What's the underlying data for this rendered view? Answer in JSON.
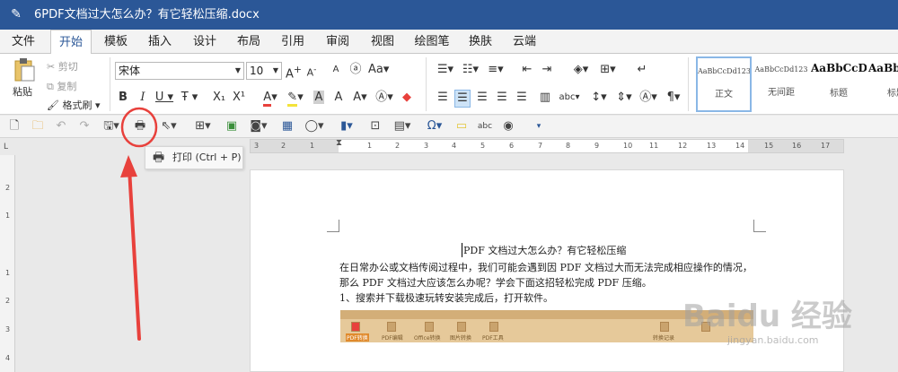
{
  "window": {
    "title": "6PDF文档过大怎么办？有它轻松压缩.docx"
  },
  "menu": {
    "tabs": [
      "文件",
      "开始",
      "模板",
      "插入",
      "设计",
      "布局",
      "引用",
      "审阅",
      "视图",
      "绘图笔",
      "换肤",
      "云端"
    ],
    "active": "开始"
  },
  "ribbon": {
    "clipboard": {
      "paste": "粘贴",
      "cut": "剪切",
      "copy": "复制",
      "format_painter": "格式刷"
    },
    "font": {
      "name": "宋体",
      "size": "10"
    },
    "styles": [
      {
        "sample": "AaBbCcDd123",
        "name": "正文"
      },
      {
        "sample": "AaBbCcDd123",
        "name": "无间距"
      },
      {
        "sample": "AaBbCcD",
        "name": "标题"
      },
      {
        "sample": "AaBbCcD",
        "name": "标题"
      }
    ]
  },
  "tooltip": {
    "text": "打印 (Ctrl + P)"
  },
  "ruler": {
    "h_ticks": [
      "3",
      "2",
      "1",
      "1",
      "2",
      "3",
      "4",
      "5",
      "6",
      "7",
      "8",
      "9",
      "10",
      "11",
      "12",
      "13",
      "14",
      "15",
      "16",
      "17"
    ],
    "v_ticks": [
      "2",
      "1",
      "1",
      "2",
      "3",
      "4"
    ]
  },
  "document": {
    "title": "PDF 文档过大怎么办？有它轻松压缩",
    "p1": "在日常办公或文档传阅过程中，我们可能会遇到因 PDF 文档过大而无法完成相应操作的情况，",
    "p2": "那么 PDF 文档过大应该怎么办呢？学会下面这招轻松完成 PDF 压缩。",
    "p3": "1、搜索并下载极速玩转安装完成后，打开软件。",
    "embed_labels": [
      "PDF转换",
      "PDF编辑",
      "Office转换",
      "图片转换",
      "PDF工具",
      "转换记录"
    ]
  },
  "watermark": {
    "text": "Baidu 经验",
    "sub": "jingyan.baidu.com"
  },
  "colors": {
    "titlebar": "#2b5797",
    "annotation": "#e8413c"
  }
}
